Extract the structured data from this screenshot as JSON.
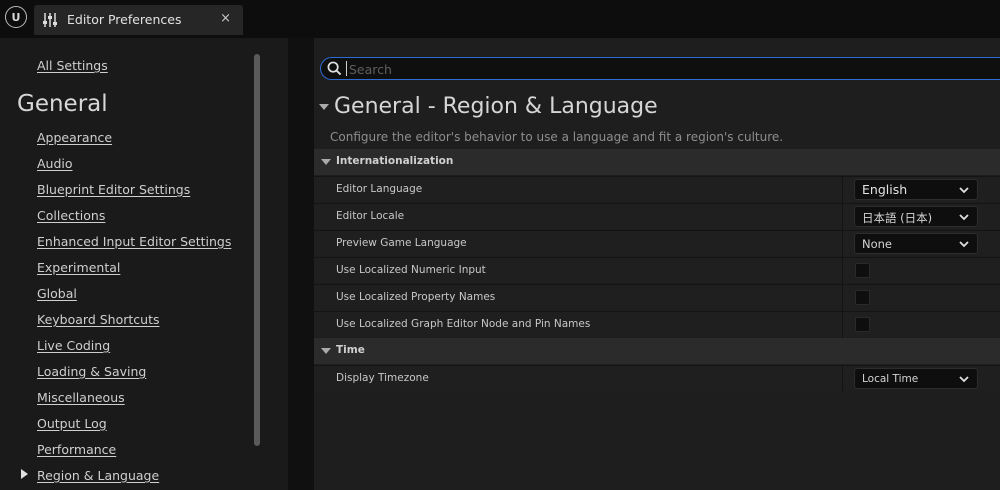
{
  "tab": {
    "title": "Editor Preferences",
    "close": "×"
  },
  "sidebar": {
    "all_settings": "All Settings",
    "heading": "General",
    "items": [
      "Appearance",
      "Audio",
      "Blueprint Editor Settings",
      "Collections",
      "Enhanced Input Editor Settings",
      "Experimental",
      "Global",
      "Keyboard Shortcuts",
      "Live Coding",
      "Loading & Saving",
      "Miscellaneous",
      "Output Log",
      "Performance",
      "Region & Language"
    ],
    "selected_index": 13
  },
  "search": {
    "placeholder": "Search",
    "value": ""
  },
  "main": {
    "title": "General - Region & Language",
    "description": "Configure the editor's behavior to use a language and fit a region's culture.",
    "sections": [
      {
        "name": "Internationalization",
        "properties": [
          {
            "label": "Editor Language",
            "type": "dropdown",
            "value": "English"
          },
          {
            "label": "Editor Locale",
            "type": "dropdown",
            "value": "日本語 (日本)"
          },
          {
            "label": "Preview Game Language",
            "type": "dropdown",
            "value": "None"
          },
          {
            "label": "Use Localized Numeric Input",
            "type": "checkbox",
            "checked": false
          },
          {
            "label": "Use Localized Property Names",
            "type": "checkbox",
            "checked": false
          },
          {
            "label": "Use Localized Graph Editor Node and Pin Names",
            "type": "checkbox",
            "checked": false
          }
        ]
      },
      {
        "name": "Time",
        "properties": [
          {
            "label": "Display Timezone",
            "type": "dropdown",
            "value": "Local Time"
          }
        ]
      }
    ]
  },
  "icons": {
    "logo": "unreal-logo-icon",
    "tab": "sliders-icon",
    "search": "search-icon",
    "collapse": "triangle-down-icon",
    "dropdown": "chevron-down-icon",
    "selected": "triangle-right-icon"
  },
  "colors": {
    "accent": "#2f6bd6",
    "background": "#151515",
    "panel": "#1e1e1e"
  }
}
